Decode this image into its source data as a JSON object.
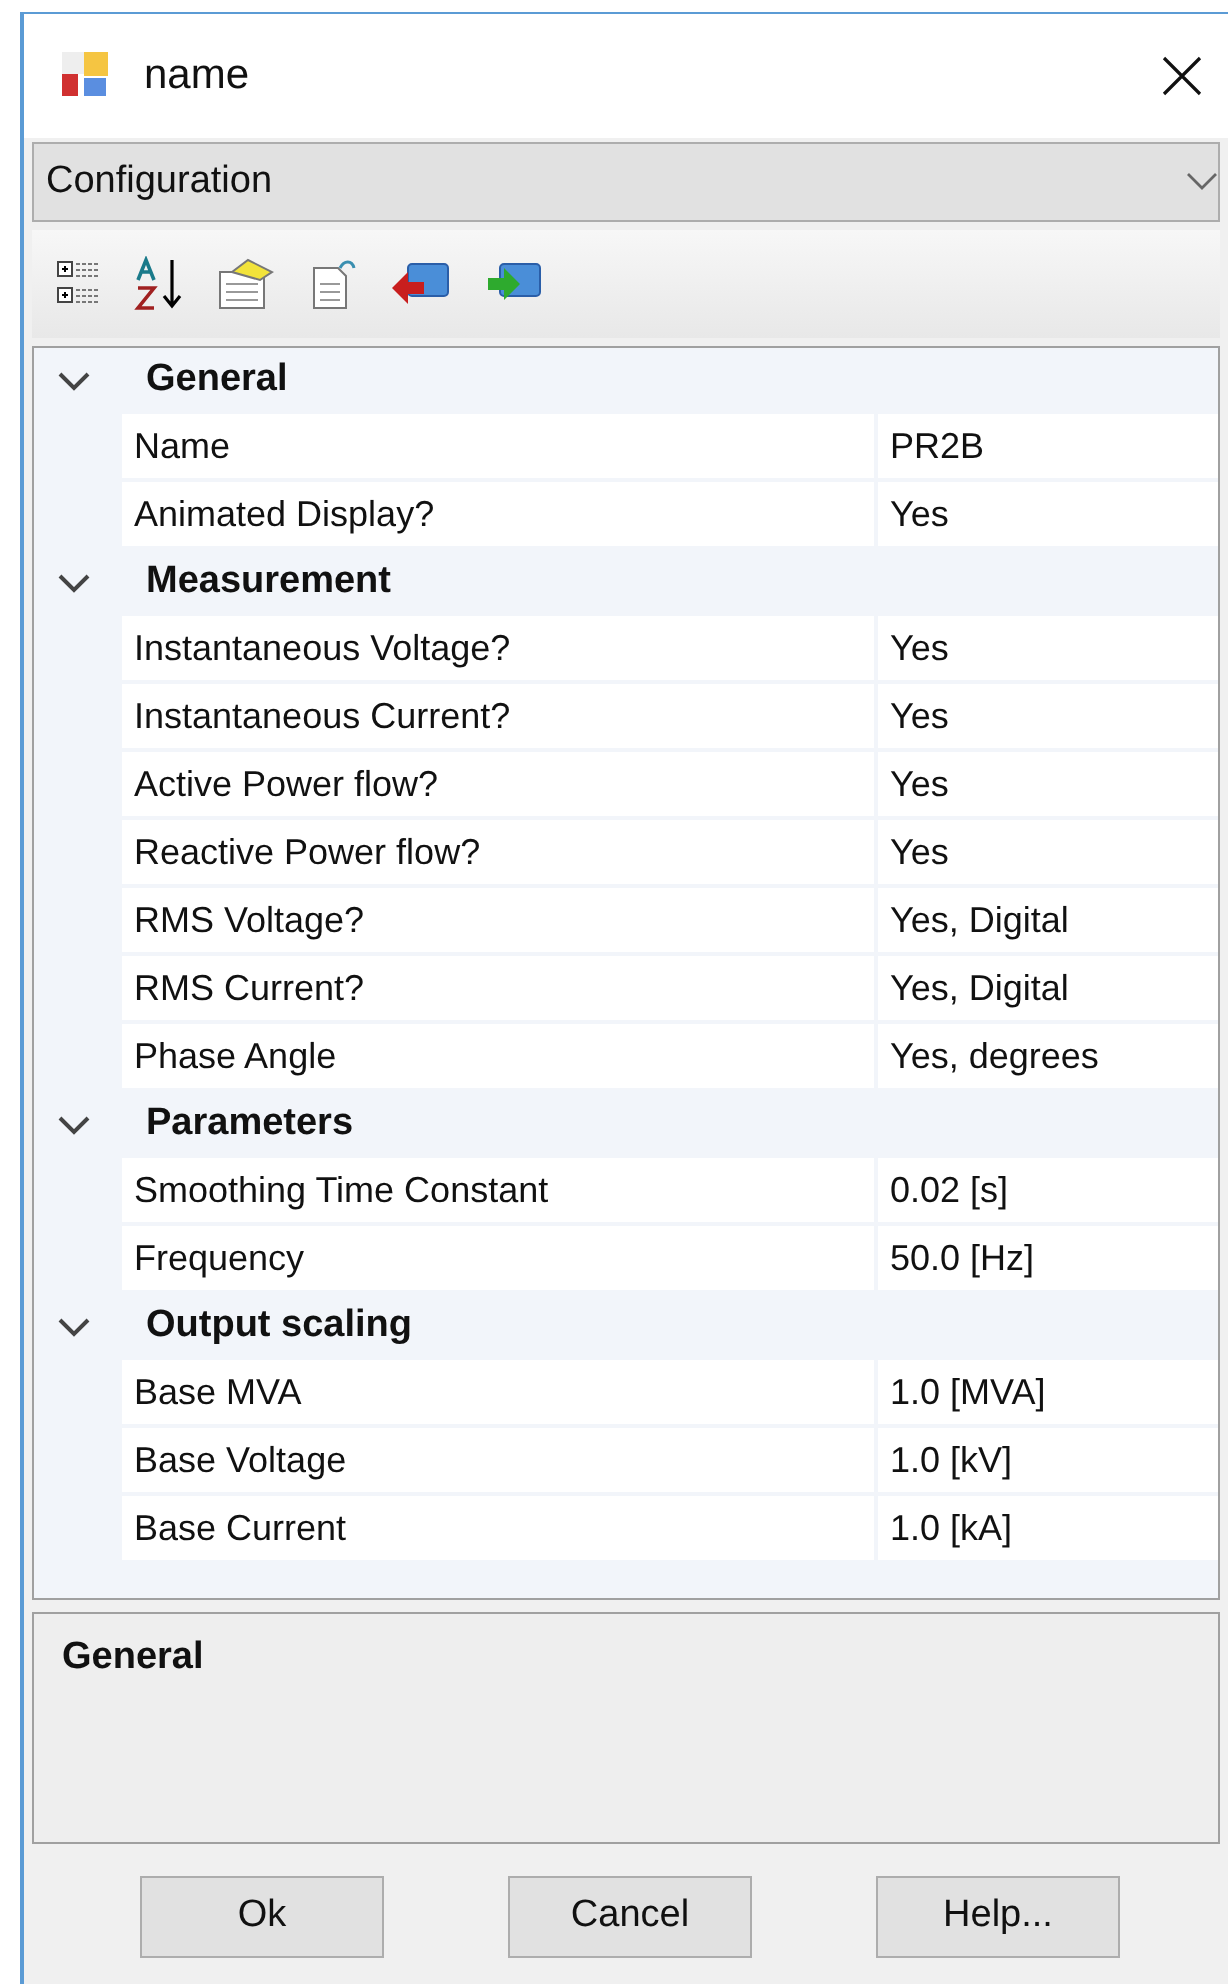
{
  "window": {
    "title": "name"
  },
  "object_dropdown": {
    "value": "Configuration"
  },
  "categories": [
    {
      "name": "General",
      "expanded": true,
      "properties": [
        {
          "name": "Name",
          "value": "PR2B"
        },
        {
          "name": "Animated Display?",
          "value": "Yes"
        }
      ]
    },
    {
      "name": "Measurement",
      "expanded": true,
      "properties": [
        {
          "name": "Instantaneous Voltage?",
          "value": "Yes"
        },
        {
          "name": "Instantaneous Current?",
          "value": "Yes"
        },
        {
          "name": "Active Power flow?",
          "value": "Yes"
        },
        {
          "name": "Reactive Power flow?",
          "value": "Yes"
        },
        {
          "name": "RMS Voltage?",
          "value": "Yes, Digital"
        },
        {
          "name": "RMS Current?",
          "value": "Yes, Digital"
        },
        {
          "name": "Phase Angle",
          "value": "Yes, degrees"
        }
      ]
    },
    {
      "name": "Parameters",
      "expanded": true,
      "properties": [
        {
          "name": "Smoothing Time Constant",
          "value": "0.02 [s]"
        },
        {
          "name": "Frequency",
          "value": "50.0 [Hz]"
        }
      ]
    },
    {
      "name": "Output scaling",
      "expanded": true,
      "properties": [
        {
          "name": "Base MVA",
          "value": "1.0 [MVA]"
        },
        {
          "name": "Base Voltage",
          "value": "1.0 [kV]"
        },
        {
          "name": "Base Current",
          "value": "1.0 [kA]"
        }
      ]
    }
  ],
  "description": {
    "title": "General"
  },
  "buttons": [
    "Ok",
    "Cancel",
    "Help..."
  ]
}
